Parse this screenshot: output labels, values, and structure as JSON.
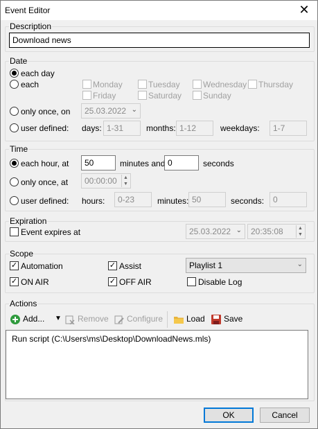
{
  "window": {
    "title": "Event Editor",
    "close_glyph": "✕"
  },
  "description": {
    "label": "Description",
    "value": "Download news"
  },
  "date": {
    "label": "Date",
    "each_day": "each day",
    "each": "each",
    "weekdays": [
      "Monday",
      "Tuesday",
      "Wednesday",
      "Thursday",
      "Friday",
      "Saturday",
      "Sunday"
    ],
    "only_once_on": "only once, on",
    "only_once_date": "25.03.2022",
    "user_defined": "user defined:",
    "days_label": "days:",
    "days_value": "1-31",
    "months_label": "months:",
    "months_value": "1-12",
    "weekdays_label": "weekdays:",
    "weekdays_value": "1-7"
  },
  "time": {
    "label": "Time",
    "each_hour_at": "each hour, at",
    "minutes_value": "50",
    "minutes_and": "minutes and",
    "seconds_value": "0",
    "seconds": "seconds",
    "only_once_at": "only once, at",
    "only_once_time": "00:00:00",
    "user_defined": "user defined:",
    "hours_label": "hours:",
    "hours_value": "0-23",
    "minutes_label": "minutes:",
    "minutes_ud_value": "50",
    "seconds_label": "seconds:",
    "seconds_ud_value": "0"
  },
  "expiration": {
    "label": "Expiration",
    "expires_label": "Event expires at",
    "date": "25.03.2022",
    "time": "20:35:08"
  },
  "scope": {
    "label": "Scope",
    "automation": "Automation",
    "assist": "Assist",
    "playlist": "Playlist 1",
    "on_air": "ON AIR",
    "off_air": "OFF AIR",
    "disable_log": "Disable Log"
  },
  "actions": {
    "label": "Actions",
    "add": "Add...",
    "remove": "Remove",
    "configure": "Configure",
    "load": "Load",
    "save": "Save",
    "items": [
      "Run script (C:\\Users\\ms\\Desktop\\DownloadNews.mls)"
    ]
  },
  "buttons": {
    "ok": "OK",
    "cancel": "Cancel"
  },
  "colors": {
    "accent": "#0078d7",
    "add_icon": "#2e9a3c",
    "folder_icon": "#e8b43c",
    "save_icon": "#c0392b"
  }
}
